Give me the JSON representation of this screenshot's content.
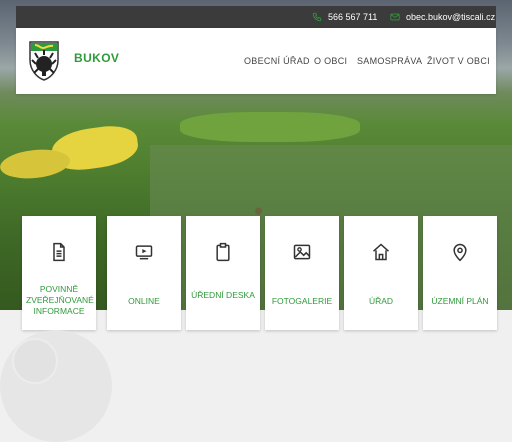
{
  "topbar": {
    "phone": "566 567 711",
    "email": "obec.bukov@tiscali.cz",
    "icons": {
      "phone": "phone-icon",
      "email": "mail-icon"
    },
    "accent": "#2f9a3b"
  },
  "brand": {
    "name": "BUKOV",
    "logo_icon": "coat-of-arms"
  },
  "nav": [
    {
      "label": "OBECNÍ ÚŘAD"
    },
    {
      "label": "O OBCI"
    },
    {
      "label": "SAMOSPRÁVA"
    },
    {
      "label": "ŽIVOT V OBCI"
    }
  ],
  "tiles": [
    {
      "label": "POVINNĚ ZVEŘEJŇOVANÉ INFORMACE",
      "icon": "document-icon"
    },
    {
      "label": "ONLINE",
      "icon": "video-icon"
    },
    {
      "label": "ÚŘEDNÍ DESKA",
      "icon": "clipboard-icon"
    },
    {
      "label": "FOTOGALERIE",
      "icon": "image-icon"
    },
    {
      "label": "ÚŘAD",
      "icon": "home-icon"
    },
    {
      "label": "ÚZEMNÍ PLÁN",
      "icon": "map-pin-icon"
    }
  ],
  "colors": {
    "topbar_bg": "#3b3b3b",
    "header_bg": "#ffffff",
    "accent_green": "#2f9a3b",
    "page_bg": "#f0f0f0"
  }
}
